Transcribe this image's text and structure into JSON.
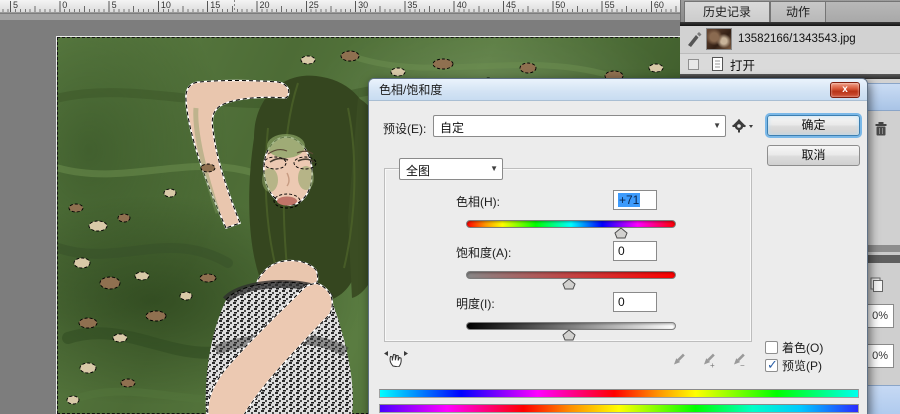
{
  "ruler": {
    "labels": [
      "5",
      "0",
      "5",
      "10",
      "15",
      "20",
      "25",
      "30",
      "35",
      "40",
      "45",
      "50",
      "55",
      "60"
    ]
  },
  "panels": {
    "history": {
      "tabs": [
        {
          "label": "历史记录"
        },
        {
          "label": "动作"
        }
      ],
      "items": [
        {
          "label": "13582166/1343543.jpg"
        },
        {
          "label": "打开"
        }
      ]
    },
    "right_edge": {
      "field1": "0%",
      "field2": "0%"
    }
  },
  "dialog": {
    "title": "色相/饱和度",
    "preset_label": "预设(E):",
    "preset_value": "自定",
    "ok": "确定",
    "cancel": "取消",
    "channel": "全图",
    "rows": {
      "hue": {
        "label": "色相(H):",
        "value": "+71"
      },
      "saturation": {
        "label": "饱和度(A):",
        "value": "0"
      },
      "lightness": {
        "label": "明度(I):",
        "value": "0"
      }
    },
    "colorize": "着色(O)",
    "preview": "预览(P)"
  },
  "colors": {
    "selection_highlight": "#3d9bfc",
    "titlebar": "#d3e3f4",
    "dialog_bg": "#ececec",
    "workspace": "#7d7d7d",
    "focus_ring": "#3c7fb1"
  }
}
